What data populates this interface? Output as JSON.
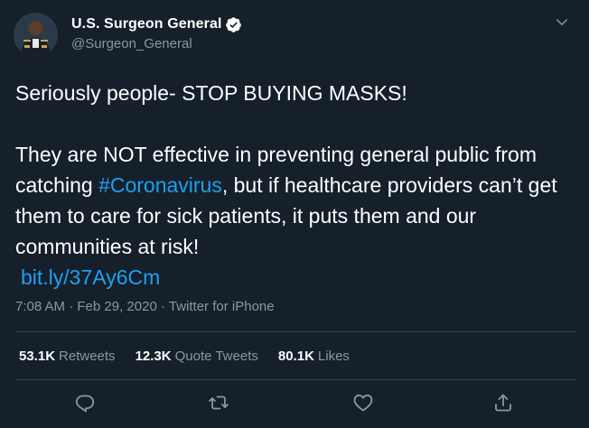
{
  "account": {
    "display_name": "U.S. Surgeon General",
    "handle": "@Surgeon_General",
    "verified": true
  },
  "tweet": {
    "line1": "Seriously people- STOP BUYING MASKS!",
    "para2_before_hashtag": "They are NOT effective in preventing general public from catching ",
    "hashtag": "#Coronavirus",
    "para2_after_hashtag": ", but if healthcare providers can’t get them to care for sick patients, it puts them and our communities at risk!",
    "link": "bit.ly/37Ay6Cm"
  },
  "meta": {
    "time": "7:08 AM",
    "date": "Feb 29, 2020",
    "source": "Twitter for iPhone",
    "separator": "·"
  },
  "stats": {
    "retweets_count": "53.1K",
    "retweets_label": "Retweets",
    "quote_count": "12.3K",
    "quote_label": "Quote Tweets",
    "likes_count": "80.1K",
    "likes_label": "Likes"
  },
  "icons": {
    "verified": "verified-badge-icon",
    "caret": "chevron-down-icon",
    "reply": "reply-icon",
    "retweet": "retweet-icon",
    "like": "heart-icon",
    "share": "share-icon"
  },
  "colors": {
    "background": "#15202b",
    "accent": "#1da1f2",
    "secondary_text": "#8899a6",
    "divider": "#38444d"
  }
}
